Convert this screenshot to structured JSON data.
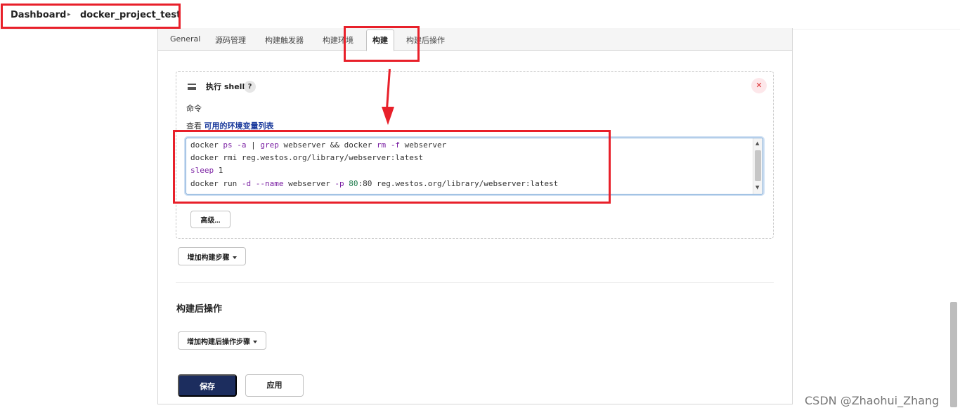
{
  "breadcrumb": {
    "home": "Dashboard",
    "project": "docker_project_test"
  },
  "tabs": [
    {
      "label": "General",
      "active": false
    },
    {
      "label": "源码管理",
      "active": false
    },
    {
      "label": "构建触发器",
      "active": false
    },
    {
      "label": "构建环境",
      "active": false
    },
    {
      "label": "构建",
      "active": true
    },
    {
      "label": "构建后操作",
      "active": false
    }
  ],
  "build_step": {
    "title": "执行 shell",
    "help": "?",
    "close": "✕",
    "command_label": "命令",
    "env_prefix": "查看",
    "env_link": "可用的环境变量列表",
    "code_lines": [
      [
        {
          "t": "docker ",
          "c": ""
        },
        {
          "t": "ps",
          "c": "kw"
        },
        {
          "t": " ",
          "c": ""
        },
        {
          "t": "-a",
          "c": "kw"
        },
        {
          "t": " | ",
          "c": ""
        },
        {
          "t": "grep",
          "c": "kw"
        },
        {
          "t": " webserver && docker ",
          "c": ""
        },
        {
          "t": "rm",
          "c": "kw"
        },
        {
          "t": " ",
          "c": ""
        },
        {
          "t": "-f",
          "c": "kw"
        },
        {
          "t": " webserver",
          "c": ""
        }
      ],
      [
        {
          "t": "docker rmi reg.westos.org/library/webserver:latest",
          "c": ""
        }
      ],
      [
        {
          "t": "sleep",
          "c": "kw"
        },
        {
          "t": " 1",
          "c": ""
        }
      ],
      [
        {
          "t": "docker run ",
          "c": ""
        },
        {
          "t": "-d",
          "c": "kw"
        },
        {
          "t": " ",
          "c": ""
        },
        {
          "t": "--name",
          "c": "kw"
        },
        {
          "t": " webserver ",
          "c": ""
        },
        {
          "t": "-p",
          "c": "kw"
        },
        {
          "t": " ",
          "c": ""
        },
        {
          "t": "80",
          "c": "num"
        },
        {
          "t": ":80 reg.westos.org/library/webserver:latest",
          "c": ""
        }
      ]
    ],
    "advanced_button": "高级..."
  },
  "add_build_step_button": "增加构建步骤",
  "post_build": {
    "title": "构建后操作",
    "add_button": "增加构建后操作步骤"
  },
  "actions": {
    "save": "保存",
    "apply": "应用"
  },
  "watermark": "CSDN @Zhaohui_Zhang",
  "colors": {
    "annotation": "#e8202a",
    "save_button": "#1c2d5e",
    "env_link": "#1a3a9c",
    "keyword": "#7a1fa2",
    "number": "#1c7a4a"
  }
}
